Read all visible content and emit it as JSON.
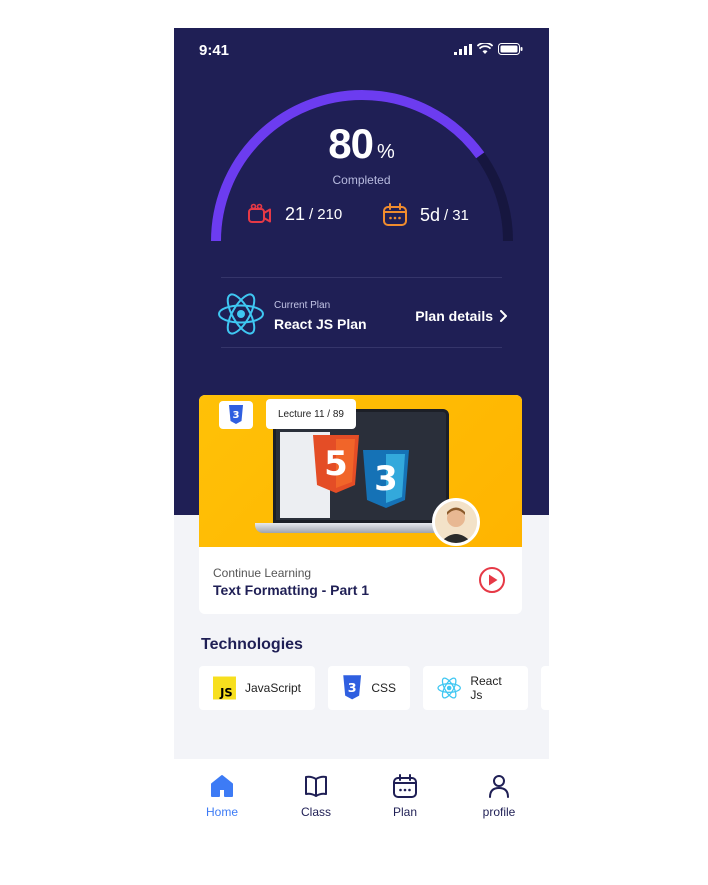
{
  "status": {
    "time": "9:41"
  },
  "progress": {
    "value": "80",
    "percent_sign": "%",
    "fraction": 0.8,
    "label": "Completed"
  },
  "stats": {
    "videos": {
      "done": "21",
      "sep": "/",
      "total": "210",
      "icon": "video-camera-icon"
    },
    "days": {
      "done": "5d",
      "sep": "/",
      "total": "31",
      "icon": "calendar-icon"
    }
  },
  "plan": {
    "subtitle": "Current Plan",
    "name": "React JS Plan",
    "details_label": "Plan details",
    "icon": "react-logo-icon"
  },
  "course": {
    "lecture_chip": "Lecture 11 / 89",
    "continue_label": "Continue Learning",
    "title": "Text Formatting - Part 1"
  },
  "technologies": {
    "title": "Technologies",
    "items": [
      {
        "label": "JavaScript",
        "icon": "js-logo-icon"
      },
      {
        "label": "CSS",
        "icon": "css3-logo-icon"
      },
      {
        "label": "React Js",
        "icon": "react-logo-icon"
      }
    ]
  },
  "tabs": [
    {
      "label": "Home",
      "icon": "home-icon",
      "active": true
    },
    {
      "label": "Class",
      "icon": "book-icon",
      "active": false
    },
    {
      "label": "Plan",
      "icon": "calendar-icon",
      "active": false
    },
    {
      "label": "profile",
      "icon": "user-icon",
      "active": false
    }
  ],
  "colors": {
    "hero_bg": "#1f1f55",
    "gauge": "#6c3cf0",
    "accent_red": "#e63946",
    "accent_orange": "#f08c2e",
    "react": "#3fc7f2",
    "tab_active": "#3d7bf5"
  }
}
